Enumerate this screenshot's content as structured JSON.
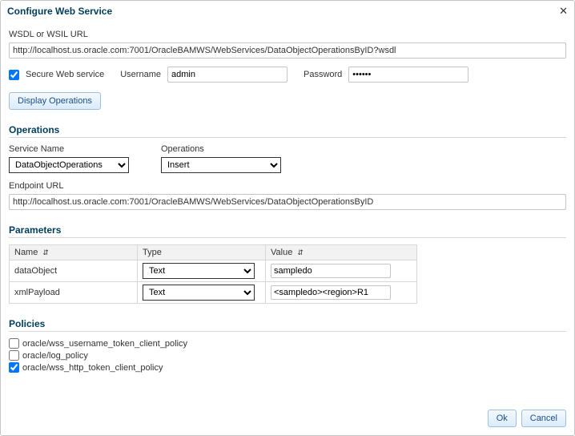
{
  "dialog": {
    "title": "Configure Web Service"
  },
  "url": {
    "label": "WSDL or WSIL URL",
    "value": "http://localhost.us.oracle.com:7001/OracleBAMWS/WebServices/DataObjectOperationsByID?wsdl"
  },
  "secure": {
    "label": "Secure Web service",
    "checked": true
  },
  "username": {
    "label": "Username",
    "value": "admin"
  },
  "password": {
    "label": "Password",
    "value": "••••••"
  },
  "displayOpsButton": "Display Operations",
  "operations": {
    "title": "Operations",
    "serviceName": {
      "label": "Service Name",
      "value": "DataObjectOperations"
    },
    "operationsSel": {
      "label": "Operations",
      "value": "Insert"
    },
    "endpoint": {
      "label": "Endpoint URL",
      "value": "http://localhost.us.oracle.com:7001/OracleBAMWS/WebServices/DataObjectOperationsByID"
    }
  },
  "parameters": {
    "title": "Parameters",
    "headers": {
      "name": "Name",
      "type": "Type",
      "value": "Value"
    },
    "rows": [
      {
        "name": "dataObject",
        "type": "Text",
        "value": "sampledo"
      },
      {
        "name": "xmlPayload",
        "type": "Text",
        "value": "<sampledo><region>R1"
      }
    ]
  },
  "policies": {
    "title": "Policies",
    "items": [
      {
        "label": "oracle/wss_username_token_client_policy",
        "checked": false
      },
      {
        "label": "oracle/log_policy",
        "checked": false
      },
      {
        "label": "oracle/wss_http_token_client_policy",
        "checked": true
      }
    ]
  },
  "footer": {
    "ok": "Ok",
    "cancel": "Cancel"
  }
}
